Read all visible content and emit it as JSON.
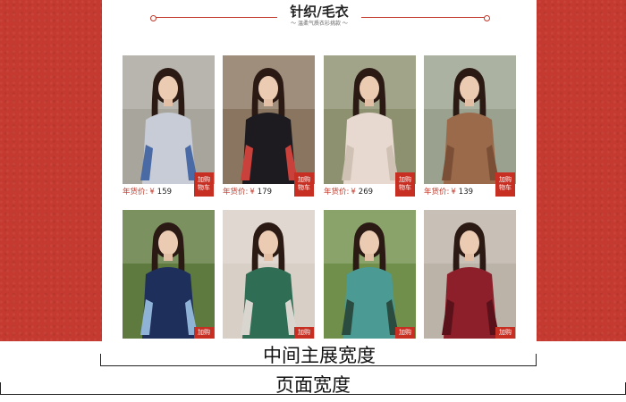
{
  "section": {
    "title": "针织/毛衣",
    "subtitle": "～ 温柔气质衣衫挑款 ～"
  },
  "price_label": "年货价:",
  "currency": "¥",
  "cart_label_line1": "加购",
  "cart_label_line2": "物车",
  "products": [
    {
      "price": "159",
      "sweater_color": "#c8ccd6",
      "accent_color": "#4a6aa6",
      "bg_color": "#a8a59c"
    },
    {
      "price": "179",
      "sweater_color": "#1d1b1f",
      "accent_color": "#c9413a",
      "bg_color": "#8a7660"
    },
    {
      "price": "269",
      "sweater_color": "#e7d9cf",
      "accent_color": "#cfc1b3",
      "bg_color": "#8d9170"
    },
    {
      "price": "139",
      "sweater_color": "#9b6a4b",
      "accent_color": "#7a4f35",
      "bg_color": "#9aa18e"
    },
    {
      "price": "",
      "sweater_color": "#1f2f5c",
      "accent_color": "#8fb3d6",
      "bg_color": "#5e7a3e"
    },
    {
      "price": "",
      "sweater_color": "#2f6e55",
      "accent_color": "#d9d6d0",
      "bg_color": "#d8cfc6"
    },
    {
      "price": "",
      "sweater_color": "#4b9a93",
      "accent_color": "#2a4b40",
      "bg_color": "#6f8f4a"
    },
    {
      "price": "",
      "sweater_color": "#8c1f2a",
      "accent_color": "#5a1119",
      "bg_color": "#bcb3a8"
    }
  ],
  "captions": {
    "center_width": "中间主展宽度",
    "page_width": "页面宽度"
  },
  "colors": {
    "page_background": "#c53a30",
    "center_background": "#ffffff",
    "accent": "#c62f22"
  }
}
